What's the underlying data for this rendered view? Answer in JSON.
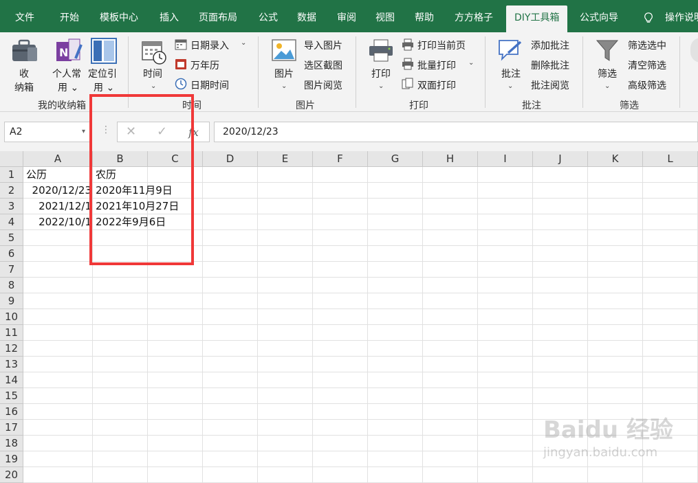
{
  "tabs": [
    "文件",
    "开始",
    "模板中心",
    "插入",
    "页面布局",
    "公式",
    "数据",
    "审阅",
    "视图",
    "帮助",
    "方方格子",
    "DIY工具箱",
    "公式向导",
    "操作说明"
  ],
  "active_tab": "DIY工具箱",
  "ribbon": {
    "box": {
      "btn1": [
        "收",
        "纳箱"
      ],
      "btn2": [
        "个人常",
        "用 ⌄"
      ],
      "btn3": [
        "定位引",
        "用 ⌄"
      ],
      "label": "我的收纳箱"
    },
    "time": {
      "big": "时间",
      "items": [
        "日期录入",
        "万年历",
        "日期时间"
      ],
      "label": "时间"
    },
    "picture": {
      "big": "图片",
      "items": [
        "导入图片",
        "选区截图",
        "图片阅览"
      ],
      "label": "图片"
    },
    "print": {
      "big": "打印",
      "items": [
        "打印当前页",
        "批量打印",
        "双面打印"
      ],
      "label": "打印"
    },
    "comment": {
      "big": "批注",
      "items": [
        "添加批注",
        "删除批注",
        "批注阅览"
      ],
      "label": "批注"
    },
    "filter": {
      "big": "筛选",
      "items": [
        "筛选选中",
        "清空筛选",
        "高级筛选"
      ],
      "label": "筛选"
    }
  },
  "formula_bar": {
    "name_box": "A2",
    "fx": "fx",
    "value": "2020/12/23"
  },
  "columns": [
    "A",
    "B",
    "C",
    "D",
    "E",
    "F",
    "G",
    "H",
    "I",
    "J",
    "K",
    "L"
  ],
  "rows": [
    "1",
    "2",
    "3",
    "4",
    "5",
    "6",
    "7",
    "8",
    "9",
    "10",
    "11",
    "12",
    "13",
    "14",
    "15",
    "16",
    "17",
    "18",
    "19",
    "20"
  ],
  "cells": {
    "A1": "公历",
    "B1": "农历",
    "A2": "2020/12/23",
    "B2": "2020年11月9日",
    "A3": "2021/12/1",
    "B3": "2021年10月27日",
    "A4": "2022/10/1",
    "B4": "2022年9月6日"
  },
  "colors": {
    "accent": "#217346",
    "highlight_box": "#f03838"
  },
  "watermark": {
    "text": "Baidu 经验",
    "sub": "jingyan.baidu.com"
  }
}
